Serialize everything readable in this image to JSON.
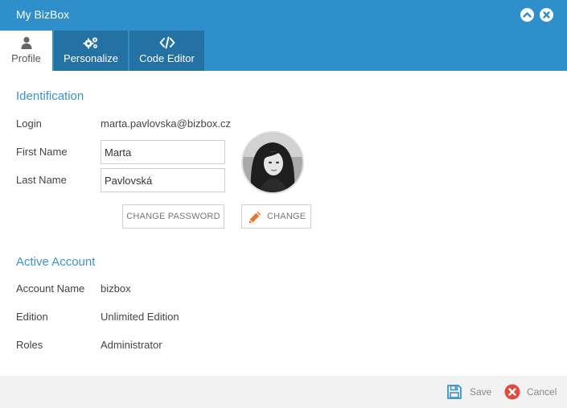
{
  "window": {
    "title": "My BizBox"
  },
  "tabs": [
    {
      "label": "Profile",
      "icon": "user-icon",
      "active": true
    },
    {
      "label": "Personalize",
      "icon": "gears-icon",
      "active": false
    },
    {
      "label": "Code Editor",
      "icon": "code-icon",
      "active": false
    }
  ],
  "identification": {
    "title": "Identification",
    "login_label": "Login",
    "login_value": "marta.pavlovska@bizbox.cz",
    "first_name_label": "First Name",
    "first_name_value": "Marta",
    "last_name_label": "Last Name",
    "last_name_value": "Pavlovská",
    "change_password_label": "CHANGE PASSWORD",
    "change_avatar_label": "CHANGE"
  },
  "account": {
    "title": "Active Account",
    "account_name_label": "Account Name",
    "account_name_value": "bizbox",
    "edition_label": "Edition",
    "edition_value": "Unlimited Edition",
    "roles_label": "Roles",
    "roles_value": "Administrator"
  },
  "footer": {
    "save_label": "Save",
    "cancel_label": "Cancel"
  },
  "colors": {
    "header": "#2f8fca",
    "tab_inactive": "#2472a3",
    "accent": "#3a93c9",
    "pencil": "#e8772e",
    "cancel": "#e04a3f"
  }
}
